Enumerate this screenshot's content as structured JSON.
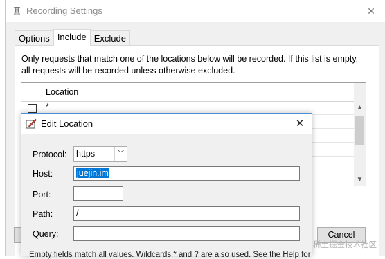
{
  "main_window": {
    "title": "Recording Settings",
    "close_glyph": "✕",
    "tabs": [
      {
        "label": "Options"
      },
      {
        "label": "Include"
      },
      {
        "label": "Exclude"
      }
    ],
    "active_tab": "Include",
    "description": "Only requests that match one of the locations below will be recorded. If this list is empty, all requests will be recorded unless otherwise excluded.",
    "grid": {
      "column_header": "Location",
      "rows": [
        {
          "checked": false,
          "value": "*"
        }
      ]
    },
    "buttons": {
      "ok_label": "",
      "cancel_label": "Cancel"
    }
  },
  "dialog": {
    "title": "Edit Location",
    "close_glyph": "✕",
    "fields": {
      "protocol_label": "Protocol:",
      "protocol_value": "https",
      "host_label": "Host:",
      "host_value": "juejin.im",
      "port_label": "Port:",
      "port_value": "",
      "path_label": "Path:",
      "path_value": "/",
      "query_label": "Query:",
      "query_value": ""
    },
    "footnote": "Empty fields match all values. Wildcards * and ? are also used. See the Help for"
  },
  "watermark": "@稀土掘金技术社区",
  "colors": {
    "selection": "#0078d7",
    "dialog_border": "#4a90d9",
    "window_bg": "#f0f0f0"
  },
  "icons": {
    "app": "charles-vase-icon",
    "dialog": "edit-location-icon"
  }
}
